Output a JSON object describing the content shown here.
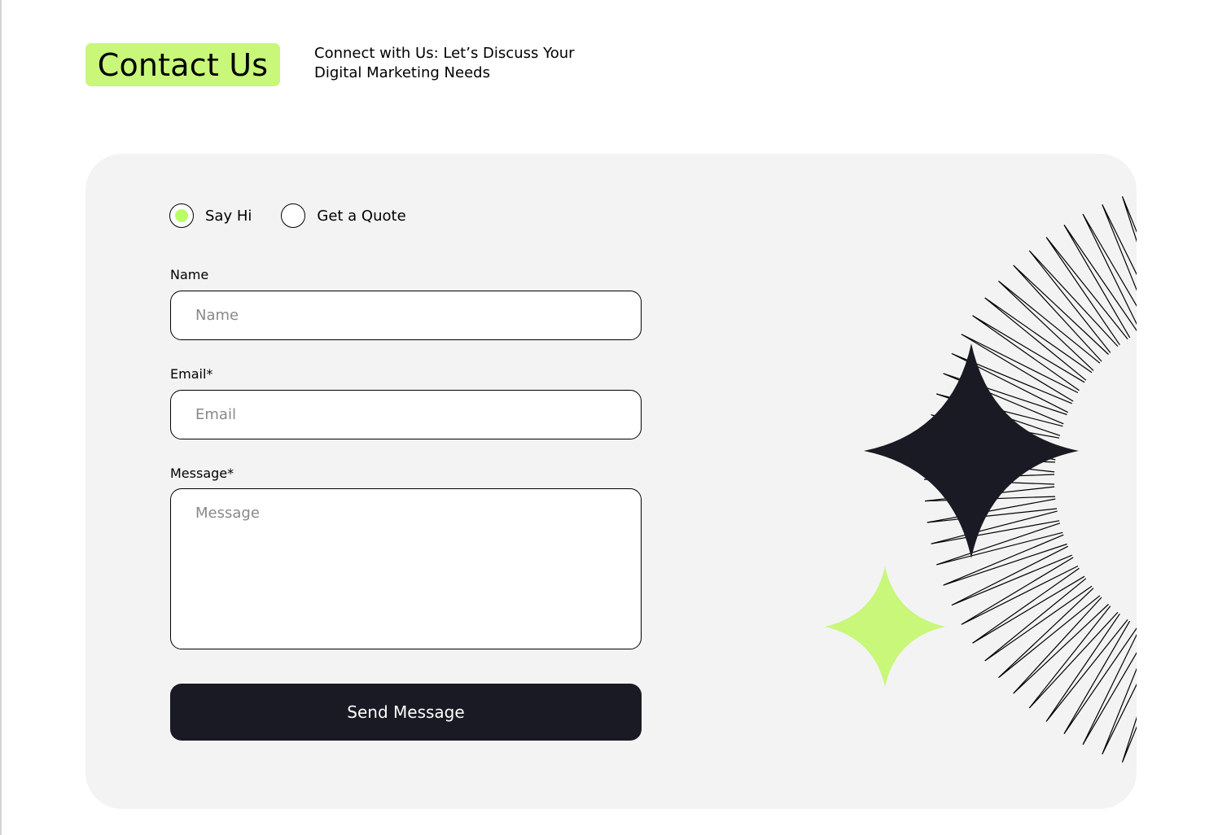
{
  "header": {
    "title": "Contact Us",
    "subtitle": "Connect with Us: Let’s Discuss Your Digital Marketing Needs"
  },
  "form": {
    "options": [
      {
        "label": "Say Hi",
        "selected": true
      },
      {
        "label": "Get a Quote",
        "selected": false
      }
    ],
    "name": {
      "label": "Name",
      "placeholder": "Name",
      "value": ""
    },
    "email": {
      "label": "Email*",
      "placeholder": "Email",
      "value": ""
    },
    "message": {
      "label": "Message*",
      "placeholder": "Message",
      "value": ""
    },
    "submit_label": "Send Message"
  },
  "decoration": {
    "icons": [
      "sunburst-lines-icon",
      "dark-sparkle-star-icon",
      "green-sparkle-star-icon"
    ],
    "colors": {
      "dark": "#191a23",
      "accent": "#b9ff66",
      "card_bg": "#f3f3f3"
    }
  }
}
